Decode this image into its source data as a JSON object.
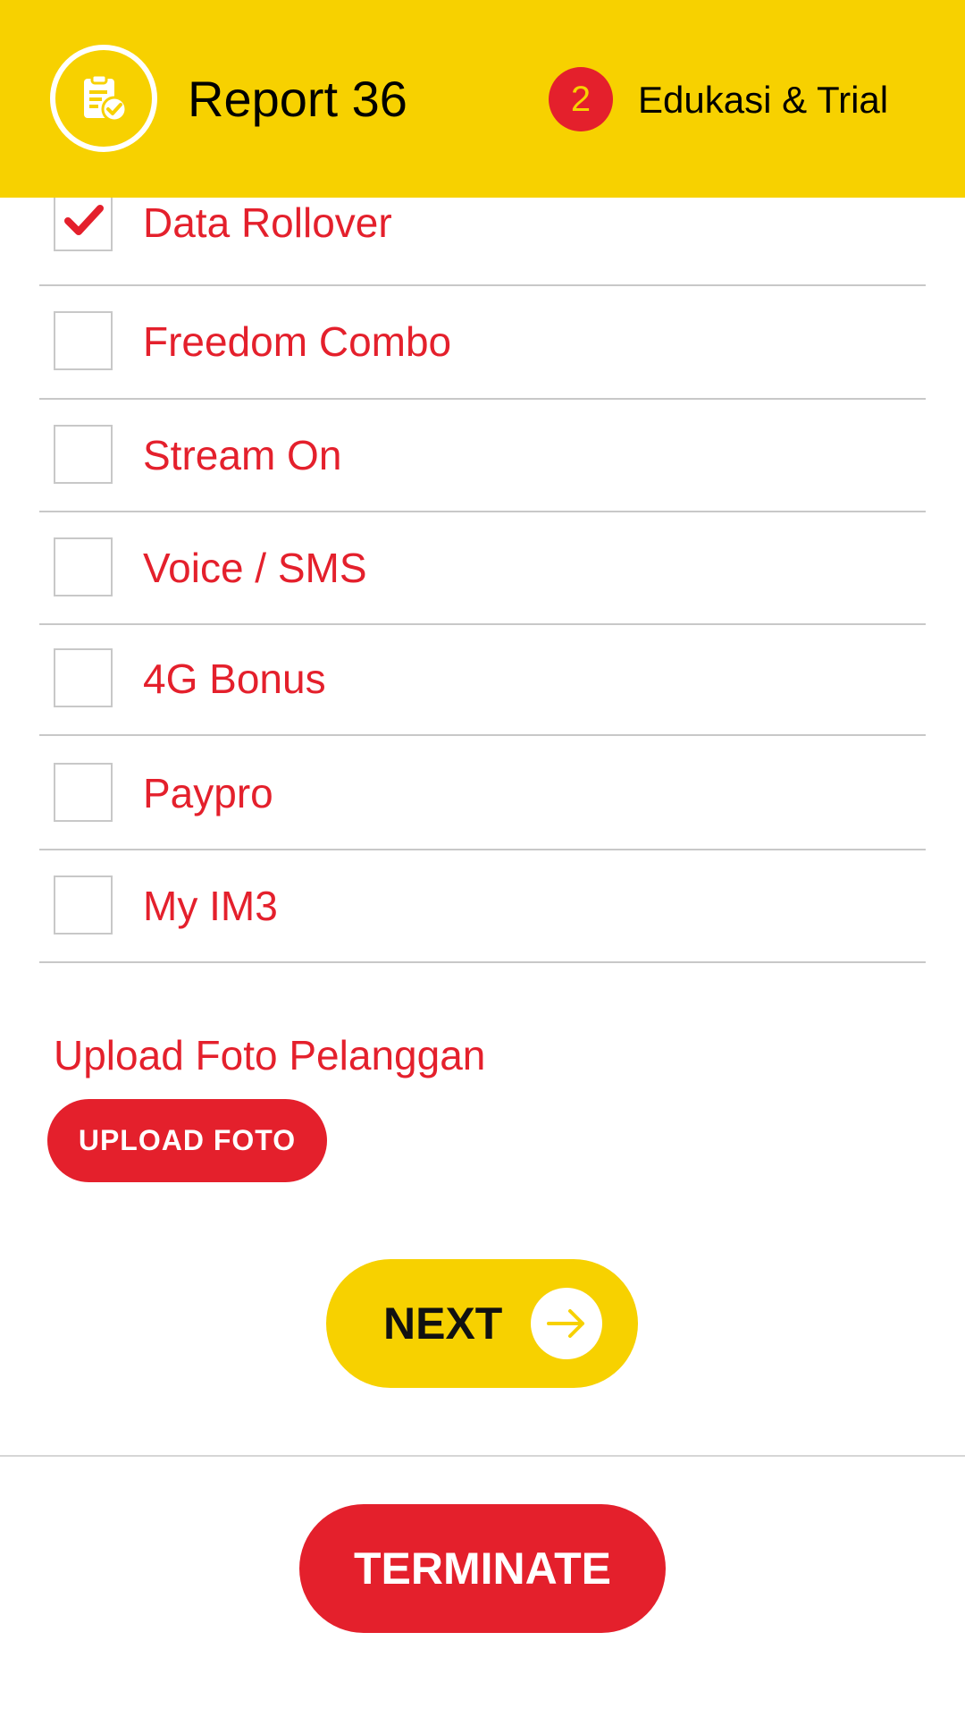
{
  "header": {
    "icon": "report-document-check-icon",
    "title": "Report 36",
    "step_number": "2",
    "step_label": "Edukasi & Trial",
    "background_color": "#F7D100",
    "badge_color": "#E4202C"
  },
  "checklist": {
    "items": [
      {
        "label": "Data Rollover",
        "checked": true
      },
      {
        "label": "Freedom Combo",
        "checked": false
      },
      {
        "label": "Stream On",
        "checked": false
      },
      {
        "label": "Voice / SMS",
        "checked": false
      },
      {
        "label": "4G Bonus",
        "checked": false
      },
      {
        "label": "Paypro",
        "checked": false
      },
      {
        "label": "My IM3",
        "checked": false
      }
    ],
    "label_color": "#E4202C"
  },
  "upload": {
    "heading": "Upload Foto Pelanggan",
    "button_label": "UPLOAD FOTO"
  },
  "actions": {
    "next_label": "NEXT",
    "next_icon": "arrow-right-icon",
    "terminate_label": "TERMINATE"
  }
}
